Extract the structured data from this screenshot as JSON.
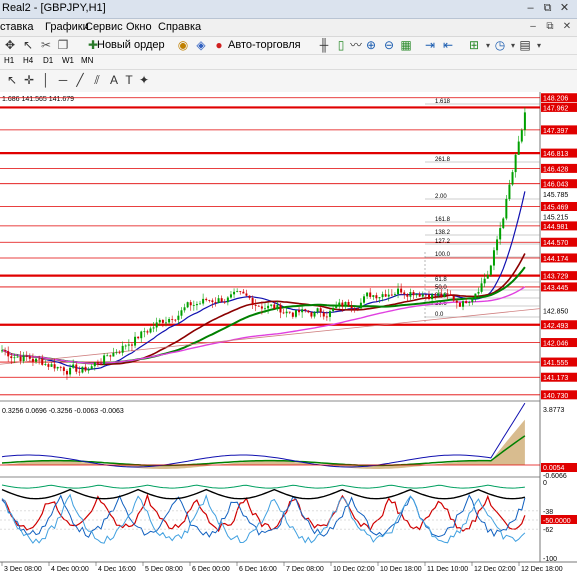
{
  "window": {
    "title": "Real2 - [GBPJPY,H1]",
    "buttons": [
      "–",
      "⧉",
      "✕"
    ]
  },
  "menu": {
    "items": [
      "ставка",
      "Графики",
      "Сервис",
      "Окно",
      "Справка"
    ],
    "window_buttons": [
      "–",
      "⧉",
      "✕"
    ]
  },
  "toolbar": {
    "new_order_label": "Новый ордер",
    "autotrade_label": "Авто-торговля",
    "icons": [
      "crosshair-icon",
      "arrow-icon",
      "cut-icon",
      "copy-icon",
      "paste-icon",
      "new-order-icon",
      "trade-icon",
      "autotrade-icon",
      "bar-chart-icon",
      "candles-icon",
      "line-chart-icon",
      "zoom-in-icon",
      "zoom-out-icon",
      "grid-icon",
      "autoscroll-icon",
      "chart-shift-icon",
      "indicators-icon",
      "periods-icon",
      "templates-icon"
    ]
  },
  "timeframes": [
    "H1",
    "H4",
    "D1",
    "W1",
    "MN"
  ],
  "chart": {
    "ohlc_text": "1.686 141.565 141.679",
    "price_labels": [
      "148.206",
      "147.962",
      "147.397",
      "146.813",
      "146.428",
      "146.043",
      "145.785",
      "145.469",
      "145.215",
      "144.981",
      "144.570",
      "144.174",
      "143.729",
      "143.445",
      "142.850",
      "142.493",
      "142.046",
      "141.555",
      "141.173",
      "140.730"
    ],
    "highlighted_price_labels": [
      "148.206",
      "147.962",
      "147.397",
      "146.813",
      "146.428",
      "146.043",
      "145.469",
      "144.981",
      "144.570",
      "144.174",
      "143.729",
      "143.445",
      "142.493",
      "142.046",
      "141.555",
      "141.173",
      "140.730"
    ],
    "fibo_labels": [
      "1.618",
      "261.8",
      "2.00",
      "161.8",
      "138.2",
      "127.2",
      "100.0",
      "61.8",
      "50.0",
      "38.2",
      "23.6",
      "0.0"
    ],
    "time_labels": [
      "3 Dec 08:00",
      "4 Dec 00:00",
      "4 Dec 16:00",
      "5 Dec 08:00",
      "6 Dec 00:00",
      "6 Dec 16:00",
      "7 Dec 08:00",
      "10 Dec 02:00",
      "10 Dec 18:00",
      "11 Dec 10:00",
      "12 Dec 02:00",
      "12 Dec 18:00"
    ],
    "macd_text": "0.3256 0.0696 -0.3256 -0.0063 -0.0063",
    "macd_scale": [
      "3.8773",
      "0.0054",
      "-0.6066"
    ],
    "osc_scale": [
      "0",
      "-38",
      "-50.0000",
      "-62",
      "-100"
    ],
    "colors": {
      "up_candle": "#00a000",
      "down_candle": "#d00000",
      "level_line": "#e00000",
      "price_label_bg": "#e00000",
      "ma_fast": "#1010b0",
      "ma_mid": "#8b0000",
      "ma_slow": "#008000",
      "ma_long": "#e040e0"
    }
  }
}
